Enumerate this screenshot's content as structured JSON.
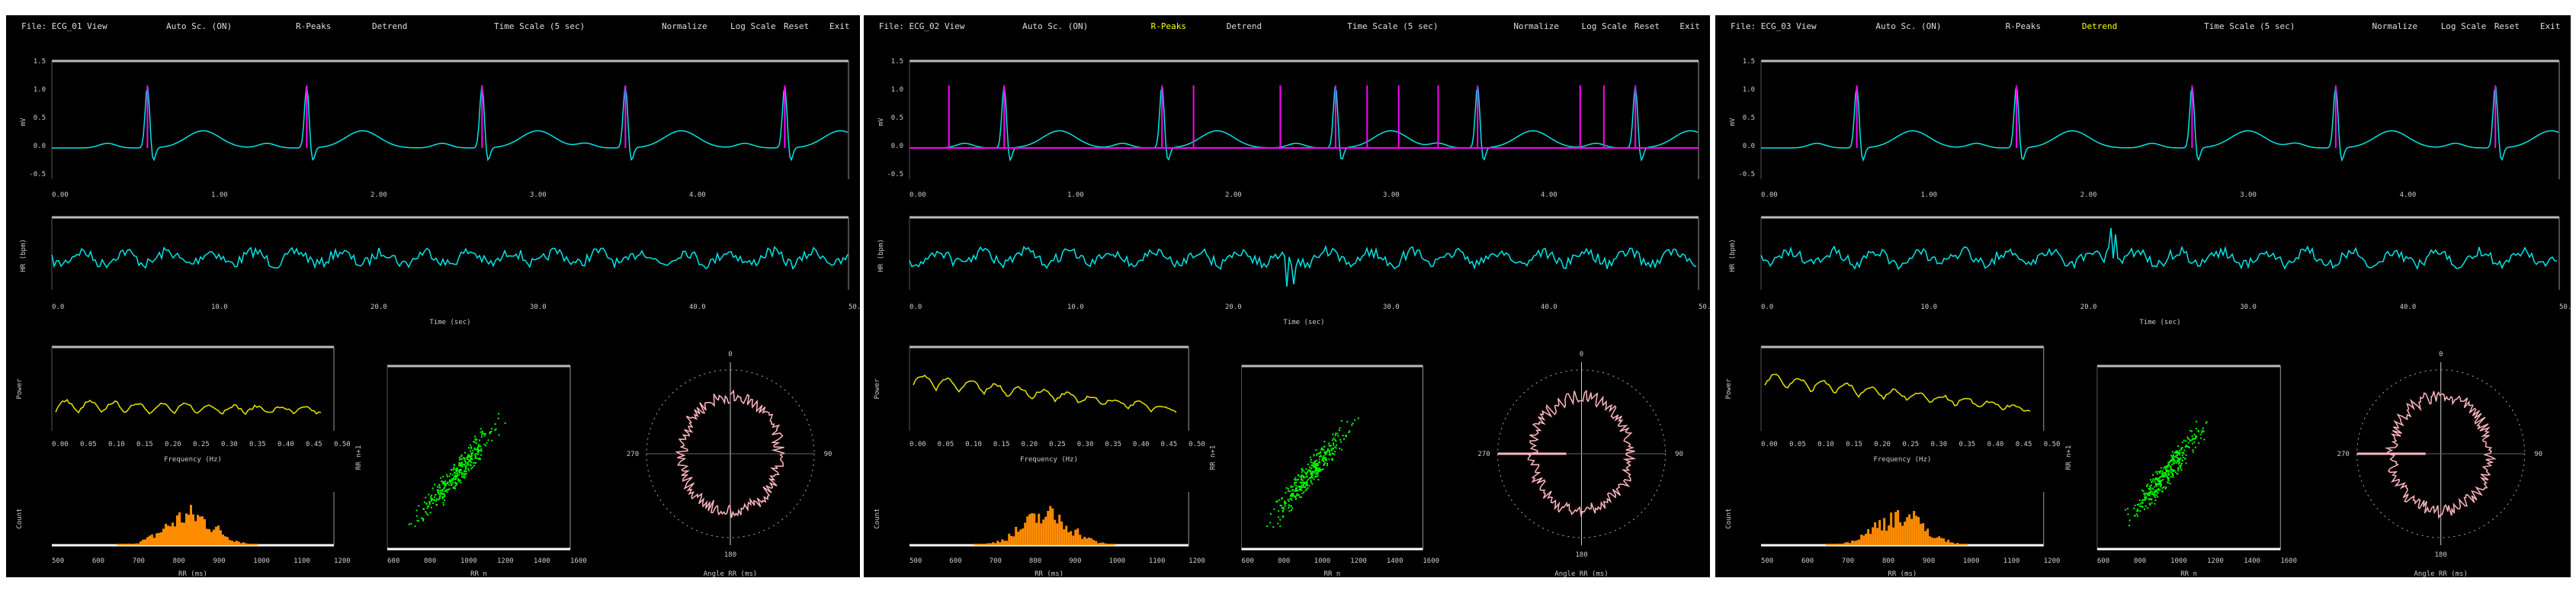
{
  "panels": [
    {
      "menu": {
        "file": "File: ECG_01 View",
        "auto_scroll": "Auto Sc. (ON)",
        "r_peaks": "R-Peaks",
        "detrend": "Detrend",
        "time_scale": "Time Scale (5 sec)",
        "normalize": "Normalize",
        "log_scale": "Log Scale",
        "reset": "Reset",
        "exit": "Exit"
      },
      "active": []
    },
    {
      "menu": {
        "file": "File: ECG_02 View",
        "auto_scroll": "Auto Sc. (ON)",
        "r_peaks": "R-Peaks",
        "detrend": "Detrend",
        "time_scale": "Time Scale (5 sec)",
        "normalize": "Normalize",
        "log_scale": "Log Scale",
        "reset": "Reset",
        "exit": "Exit"
      },
      "active": [
        "r_peaks"
      ]
    },
    {
      "menu": {
        "file": "File: ECG_03 View",
        "auto_scroll": "Auto Sc. (ON)",
        "r_peaks": "R-Peaks",
        "detrend": "Detrend",
        "time_scale": "Time Scale (5 sec)",
        "normalize": "Normalize",
        "log_scale": "Log Scale",
        "reset": "Reset",
        "exit": "Exit"
      },
      "active": [
        "detrend"
      ]
    }
  ],
  "labels": {
    "ecg_ylabel": "mV",
    "hr_ylabel": "HR (bpm)",
    "time_xlabel": "Time (sec)",
    "psd_ylabel": "Power",
    "psd_xlabel": "Frequency (Hz)",
    "hist_ylabel": "Count",
    "hist_xlabel": "RR (ms)",
    "poincare_ylabel": "RR n+1",
    "poincare_xlabel": "RR n",
    "polar_xlabel": "Angle RR (ms)",
    "polar_n": "0",
    "polar_e": "90",
    "polar_s": "180",
    "polar_w": "270"
  },
  "colors": {
    "ecg": "#00e5e5",
    "r_peak": "#ff00ff",
    "psd": "#e5e500",
    "hist": "#ff8c00",
    "scatter": "#00ff00",
    "polar": "#ffb6c1",
    "active_menu": "#ffff00"
  }
}
